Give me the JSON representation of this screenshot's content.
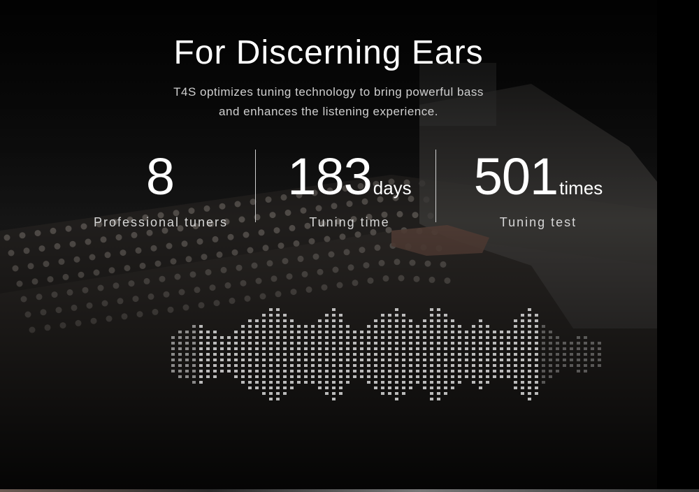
{
  "hero": {
    "title": "For Discerning Ears",
    "subtitle_line1": "T4S optimizes tuning technology to bring powerful bass",
    "subtitle_line2": "and enhances the listening experience."
  },
  "stats": [
    {
      "value": "8",
      "unit": "",
      "label": "Professional tuners"
    },
    {
      "value": "183",
      "unit": "days",
      "label": "Tuning time"
    },
    {
      "value": "501",
      "unit": "times",
      "label": "Tuning test"
    }
  ],
  "waveform_levels": [
    0.32,
    0.36,
    0.4,
    0.46,
    0.5,
    0.44,
    0.38,
    0.3,
    0.34,
    0.42,
    0.5,
    0.56,
    0.62,
    0.68,
    0.72,
    0.78,
    0.7,
    0.6,
    0.52,
    0.48,
    0.46,
    0.58,
    0.66,
    0.72,
    0.64,
    0.5,
    0.4,
    0.36,
    0.46,
    0.56,
    0.64,
    0.7,
    0.76,
    0.66,
    0.56,
    0.5,
    0.6,
    0.72,
    0.78,
    0.7,
    0.58,
    0.46,
    0.38,
    0.5,
    0.6,
    0.52,
    0.44,
    0.36,
    0.42,
    0.56,
    0.66,
    0.74,
    0.64,
    0.5,
    0.38,
    0.28,
    0.22,
    0.26,
    0.34,
    0.3,
    0.24,
    0.2
  ]
}
